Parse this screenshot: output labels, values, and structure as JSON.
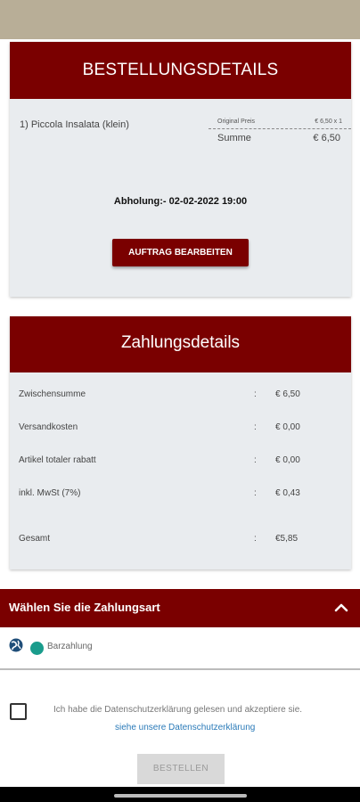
{
  "order": {
    "title": "BESTELLUNGSDETAILS",
    "item": "1) Piccola Insalata (klein)",
    "original_price_label": "Original Preis",
    "original_price_value": "€ 6,50 x 1",
    "sum_label": "Summe",
    "sum_value": "€ 6,50",
    "pickup": "Abholung:- 02-02-2022 19:00",
    "edit_button": "AUFTRAG BEARBEITEN"
  },
  "payment": {
    "title": "Zahlungsdetails",
    "rows": [
      {
        "label": "Zwischensumme",
        "colon": ":",
        "value": "€ 6,50"
      },
      {
        "label": "Versandkosten",
        "colon": ":",
        "value": "€ 0,00"
      },
      {
        "label": "Artikel totaler rabatt",
        "colon": ":",
        "value": "€ 0,00"
      },
      {
        "label": "inkl. MwSt (7%)",
        "colon": ":",
        "value": "€ 0,43"
      },
      {
        "label": "Gesamt",
        "colon": ":",
        "value": "€5,85"
      }
    ]
  },
  "method": {
    "title": "Wählen Sie die Zahlungsart",
    "option_label": "Barzahlung"
  },
  "privacy": {
    "text": "Ich habe die Datenschutzerklärung gelesen und akzeptiere sie.",
    "link": "siehe unsere Datenschutzerklärung"
  },
  "submit": {
    "label": "BESTELLEN"
  },
  "colors": {
    "brand": "#7a0000",
    "accent": "#1a9c8c",
    "link": "#2a7ab8"
  },
  "icons": {
    "collapse": "chevron-up-icon",
    "method": "globe-icon"
  }
}
